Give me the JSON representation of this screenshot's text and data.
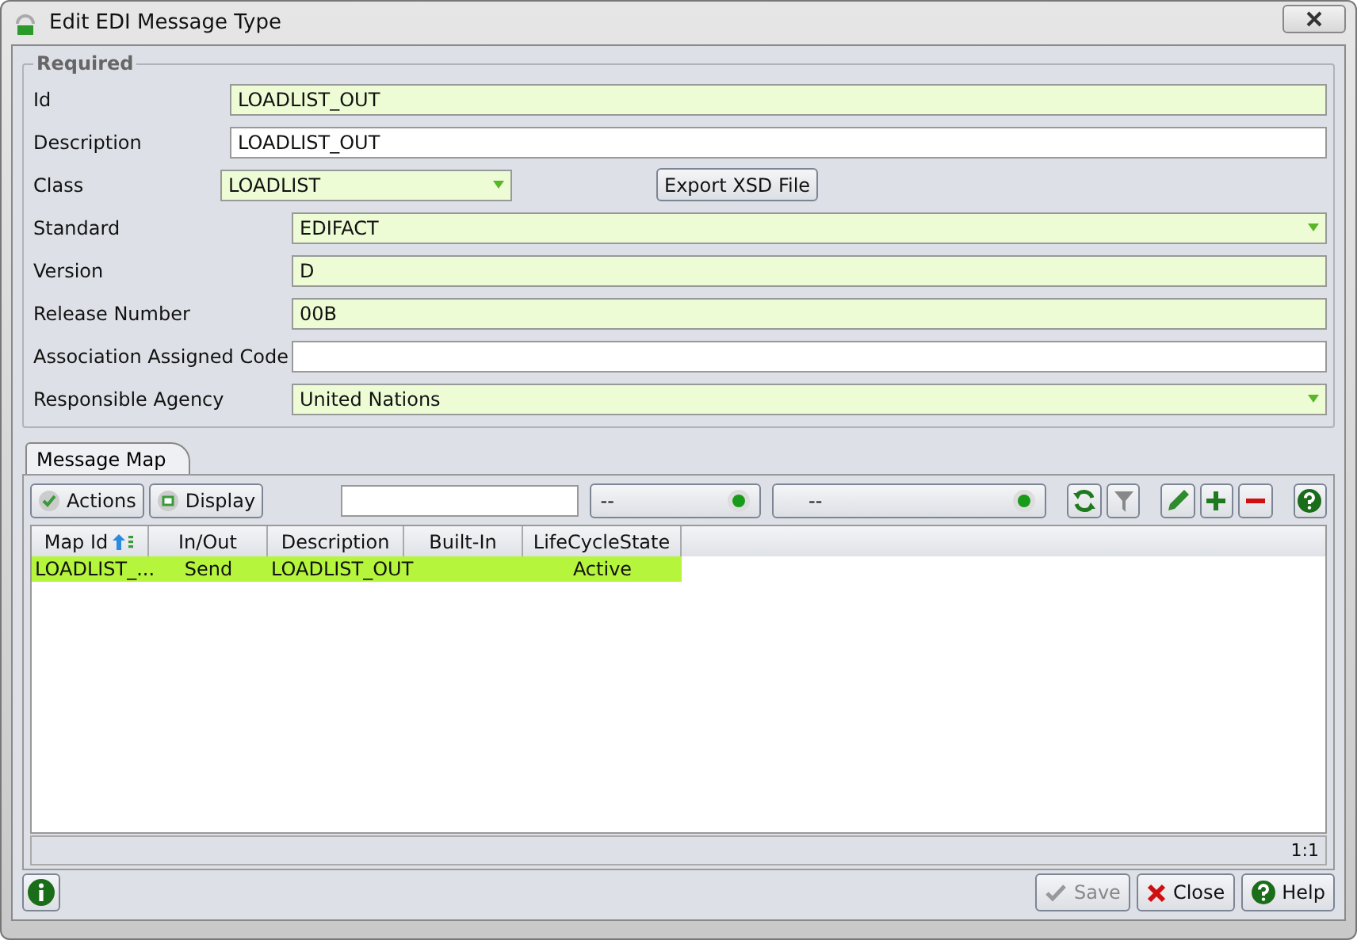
{
  "window": {
    "title": "Edit EDI Message Type"
  },
  "required": {
    "legend": "Required",
    "top_fields": [
      {
        "label": "Id",
        "value": "LOADLIST_OUT",
        "required": true
      },
      {
        "label": "Description",
        "value": "LOADLIST_OUT",
        "required": false
      }
    ],
    "class_field": {
      "label": "Class",
      "value": "LOADLIST",
      "kind": "dropdown",
      "required": true,
      "button": "Export XSD File"
    },
    "fields": [
      {
        "label": "Standard",
        "value": "EDIFACT",
        "kind": "dropdown",
        "required": true
      },
      {
        "label": "Version",
        "value": "D",
        "kind": "text",
        "required": true
      },
      {
        "label": "Release Number",
        "value": "00B",
        "kind": "text",
        "required": true
      },
      {
        "label": "Association Assigned Code",
        "kind": "text",
        "required": false
      },
      {
        "label": "Responsible Agency",
        "value": "United Nations",
        "kind": "dropdown",
        "required": true
      }
    ]
  },
  "tabs": [
    {
      "label": "Message Map",
      "selected": true
    }
  ],
  "toolbar": {
    "actions": "Actions",
    "display": "Display",
    "filter_1": "--",
    "filter_2": "--"
  },
  "table": {
    "columns": [
      "Map Id",
      "In/Out",
      "Description",
      "Built-In",
      "LifeCycleState"
    ],
    "rows": [
      {
        "cells": [
          "LOADLIST_...",
          "Send",
          "LOADLIST_OUT",
          "",
          "Active"
        ],
        "selected": true
      }
    ]
  },
  "status_bar": "1:1",
  "buttons": [
    {
      "label": "Save",
      "kind": "save",
      "disabled": true
    },
    {
      "label": "Close",
      "kind": "close",
      "disabled": false
    },
    {
      "label": "Help",
      "kind": "help",
      "disabled": false
    }
  ]
}
